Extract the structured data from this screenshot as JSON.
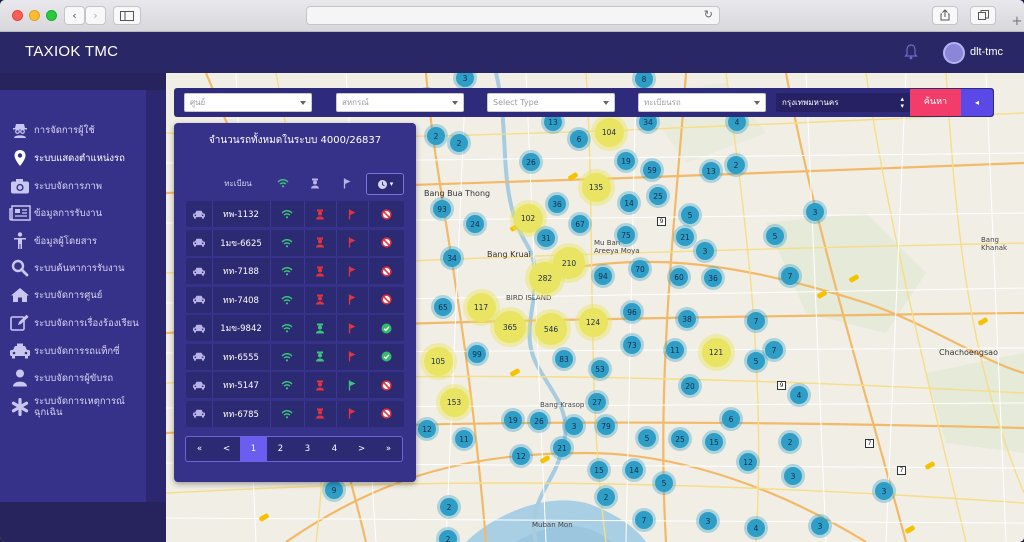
{
  "browser": {
    "back": "‹",
    "forward": "›",
    "newtab": "+"
  },
  "app": {
    "brand": "TAXIOK TMC",
    "username": "dlt-tmc"
  },
  "sidebar": {
    "items": [
      {
        "label": "การจัดการผู้ใช้",
        "icon": "user-spy-icon"
      },
      {
        "label": "ระบบแสดงตำแหน่งรถ",
        "icon": "map-pin-icon",
        "active": true
      },
      {
        "label": "ระบบจัดการภาพ",
        "icon": "camera-icon"
      },
      {
        "label": "ข้อมูลการรับงาน",
        "icon": "newspaper-icon"
      },
      {
        "label": "ข้อมูลผู้โดยสาร",
        "icon": "person-icon"
      },
      {
        "label": "ระบบค้นหาการรับงาน",
        "icon": "search-icon"
      },
      {
        "label": "ระบบจัดการศูนย์",
        "icon": "home-icon"
      },
      {
        "label": "ระบบจัดการเรื่องร้องเรียน",
        "icon": "edit-icon"
      },
      {
        "label": "ระบบจัดการรถแท็กซี่",
        "icon": "taxi-icon"
      },
      {
        "label": "ระบบจัดการผู้ขับรถ",
        "icon": "driver-icon"
      },
      {
        "label": "ระบบจัดการเหตุการณ์\nฉุกเฉิน",
        "icon": "asterisk-icon"
      }
    ]
  },
  "filters": {
    "center": "ศูนย์",
    "coop": "สหกรณ์",
    "type": "Select Type",
    "plate": "ทะเบียนรถ",
    "province": "กรุงเทพมหานคร",
    "search": "ค้นหา",
    "toggle": "◂"
  },
  "panel": {
    "title": "จำนวนรถทั้งหมดในระบบ 4000/26837",
    "col_plate": "ทะเบียน",
    "rows": [
      {
        "plate": "ทพ-1132",
        "online": true,
        "driver": "red",
        "meter": "red",
        "status": "blocked"
      },
      {
        "plate": "1มข-6625",
        "online": true,
        "driver": "red",
        "meter": "red",
        "status": "blocked"
      },
      {
        "plate": "ทท-7188",
        "online": true,
        "driver": "red",
        "meter": "red",
        "status": "blocked"
      },
      {
        "plate": "ทท-7408",
        "online": true,
        "driver": "red",
        "meter": "red",
        "status": "blocked"
      },
      {
        "plate": "1มข-9842",
        "online": true,
        "driver": "green",
        "meter": "red",
        "status": "ok"
      },
      {
        "plate": "ทท-6555",
        "online": true,
        "driver": "green",
        "meter": "red",
        "status": "ok"
      },
      {
        "plate": "ทท-5147",
        "online": true,
        "driver": "red",
        "meter": "green",
        "status": "blocked"
      },
      {
        "plate": "ทท-6785",
        "online": true,
        "driver": "red",
        "meter": "red",
        "status": "blocked"
      }
    ],
    "pager": [
      "«",
      "<",
      "1",
      "2",
      "3",
      "4",
      ">",
      "»"
    ],
    "active_page": "1"
  },
  "map": {
    "places": [
      {
        "name": "Bang Bua Thong",
        "big": true
      },
      {
        "name": "Mu Ban\nAreeya Moya"
      },
      {
        "name": "Bang Kruai",
        "big": true
      },
      {
        "name": "BIRD ISLAND"
      },
      {
        "name": "Bang Krasop"
      },
      {
        "name": "Muban Mon"
      },
      {
        "name": "Chachoengsao",
        "big": true
      },
      {
        "name": "Bang Khanak"
      }
    ],
    "clusters": [
      {
        "t": "13",
        "c": "blue"
      },
      {
        "t": "104",
        "c": "yellow"
      },
      {
        "t": "34",
        "c": "blue"
      },
      {
        "t": "4",
        "c": "blue"
      },
      {
        "t": "2",
        "c": "blue"
      },
      {
        "t": "2",
        "c": "blue"
      },
      {
        "t": "6",
        "c": "blue"
      },
      {
        "t": "26",
        "c": "blue"
      },
      {
        "t": "19",
        "c": "blue"
      },
      {
        "t": "59",
        "c": "blue"
      },
      {
        "t": "13",
        "c": "blue"
      },
      {
        "t": "2",
        "c": "blue"
      },
      {
        "t": "135",
        "c": "yellow"
      },
      {
        "t": "93",
        "c": "blue"
      },
      {
        "t": "36",
        "c": "blue"
      },
      {
        "t": "14",
        "c": "blue"
      },
      {
        "t": "25",
        "c": "blue"
      },
      {
        "t": "5",
        "c": "blue"
      },
      {
        "t": "3",
        "c": "blue"
      },
      {
        "t": "102",
        "c": "yellow"
      },
      {
        "t": "24",
        "c": "blue"
      },
      {
        "t": "67",
        "c": "blue"
      },
      {
        "t": "75",
        "c": "blue"
      },
      {
        "t": "21",
        "c": "blue"
      },
      {
        "t": "5",
        "c": "blue"
      },
      {
        "t": "31",
        "c": "blue"
      },
      {
        "t": "210",
        "c": "yellow"
      },
      {
        "t": "34",
        "c": "blue"
      },
      {
        "t": "3",
        "c": "blue"
      },
      {
        "t": "282",
        "c": "yellow"
      },
      {
        "t": "94",
        "c": "blue"
      },
      {
        "t": "70",
        "c": "blue"
      },
      {
        "t": "60",
        "c": "blue"
      },
      {
        "t": "36",
        "c": "blue"
      },
      {
        "t": "7",
        "c": "blue"
      },
      {
        "t": "117",
        "c": "yellow"
      },
      {
        "t": "65",
        "c": "blue"
      },
      {
        "t": "96",
        "c": "blue"
      },
      {
        "t": "38",
        "c": "blue"
      },
      {
        "t": "7",
        "c": "blue"
      },
      {
        "t": "365",
        "c": "yellow"
      },
      {
        "t": "546",
        "c": "yellow"
      },
      {
        "t": "124",
        "c": "yellow"
      },
      {
        "t": "73",
        "c": "blue"
      },
      {
        "t": "11",
        "c": "blue"
      },
      {
        "t": "121",
        "c": "yellow"
      },
      {
        "t": "5",
        "c": "blue"
      },
      {
        "t": "7",
        "c": "blue"
      },
      {
        "t": "105",
        "c": "yellow"
      },
      {
        "t": "99",
        "c": "blue"
      },
      {
        "t": "83",
        "c": "blue"
      },
      {
        "t": "53",
        "c": "blue"
      },
      {
        "t": "20",
        "c": "blue"
      },
      {
        "t": "153",
        "c": "yellow"
      },
      {
        "t": "27",
        "c": "blue"
      },
      {
        "t": "4",
        "c": "blue"
      },
      {
        "t": "6",
        "c": "blue"
      },
      {
        "t": "19",
        "c": "blue"
      },
      {
        "t": "26",
        "c": "blue"
      },
      {
        "t": "3",
        "c": "blue"
      },
      {
        "t": "79",
        "c": "blue"
      },
      {
        "t": "12",
        "c": "blue"
      },
      {
        "t": "11",
        "c": "blue"
      },
      {
        "t": "5",
        "c": "blue"
      },
      {
        "t": "25",
        "c": "blue"
      },
      {
        "t": "15",
        "c": "blue"
      },
      {
        "t": "2",
        "c": "blue"
      },
      {
        "t": "12",
        "c": "blue"
      },
      {
        "t": "21",
        "c": "blue"
      },
      {
        "t": "15",
        "c": "blue"
      },
      {
        "t": "14",
        "c": "blue"
      },
      {
        "t": "5",
        "c": "blue"
      },
      {
        "t": "12",
        "c": "blue"
      },
      {
        "t": "3",
        "c": "blue"
      },
      {
        "t": "3",
        "c": "blue"
      },
      {
        "t": "9",
        "c": "blue"
      },
      {
        "t": "2",
        "c": "blue"
      },
      {
        "t": "2",
        "c": "blue"
      },
      {
        "t": "7",
        "c": "blue"
      },
      {
        "t": "3",
        "c": "blue"
      },
      {
        "t": "4",
        "c": "blue"
      },
      {
        "t": "3",
        "c": "blue"
      },
      {
        "t": "3",
        "c": "blue"
      },
      {
        "t": "2",
        "c": "blue"
      },
      {
        "t": "8",
        "c": "blue"
      },
      {
        "t": "2",
        "c": "blue"
      }
    ],
    "shields": [
      "9",
      "9",
      "7",
      "7"
    ]
  },
  "colors": {
    "header": "#2a2767",
    "sidebar": "#363289",
    "panel": "#363289",
    "accent": "#6b5df0",
    "search": "#f23d6b",
    "cluster_small": "#2e9ec6",
    "cluster_large": "#e9e462"
  }
}
